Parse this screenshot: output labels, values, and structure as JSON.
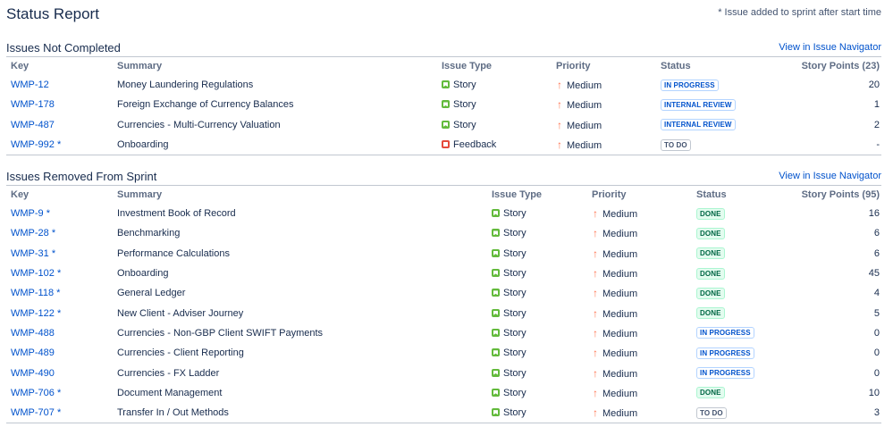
{
  "page": {
    "title": "Status Report",
    "note": "* Issue added to sprint after start time"
  },
  "not_completed": {
    "title": "Issues Not Completed",
    "link": "View in Issue Navigator",
    "columns": [
      "Key",
      "Summary",
      "Issue Type",
      "Priority",
      "Status",
      "Story Points (23)"
    ],
    "rows": [
      {
        "key": "WMP-12",
        "summary": "Money Laundering Regulations",
        "type": "Story",
        "type_icon": "story-icon",
        "priority": "Medium",
        "status": "IN PROGRESS",
        "status_color": "blue",
        "points": "20"
      },
      {
        "key": "WMP-178",
        "summary": "Foreign Exchange of Currency Balances",
        "type": "Story",
        "type_icon": "story-icon",
        "priority": "Medium",
        "status": "INTERNAL REVIEW",
        "status_color": "blue",
        "points": "1"
      },
      {
        "key": "WMP-487",
        "summary": "Currencies - Multi-Currency Valuation",
        "type": "Story",
        "type_icon": "story-icon",
        "priority": "Medium",
        "status": "INTERNAL REVIEW",
        "status_color": "blue",
        "points": "2"
      },
      {
        "key": "WMP-992 *",
        "summary": "Onboarding",
        "type": "Feedback",
        "type_icon": "feedback-icon",
        "priority": "Medium",
        "status": "TO DO",
        "status_color": "grey",
        "points": "-"
      }
    ]
  },
  "removed": {
    "title": "Issues Removed From Sprint",
    "link": "View in Issue Navigator",
    "columns": [
      "Key",
      "Summary",
      "Issue Type",
      "Priority",
      "Status",
      "Story Points (95)"
    ],
    "rows": [
      {
        "key": "WMP-9 *",
        "summary": "Investment Book of Record",
        "type": "Story",
        "type_icon": "story-icon",
        "priority": "Medium",
        "status": "DONE",
        "status_color": "green",
        "points": "16"
      },
      {
        "key": "WMP-28 *",
        "summary": "Benchmarking",
        "type": "Story",
        "type_icon": "story-icon",
        "priority": "Medium",
        "status": "DONE",
        "status_color": "green",
        "points": "6"
      },
      {
        "key": "WMP-31 *",
        "summary": "Performance Calculations",
        "type": "Story",
        "type_icon": "story-icon",
        "priority": "Medium",
        "status": "DONE",
        "status_color": "green",
        "points": "6"
      },
      {
        "key": "WMP-102 *",
        "summary": "Onboarding",
        "type": "Story",
        "type_icon": "story-icon",
        "priority": "Medium",
        "status": "DONE",
        "status_color": "green",
        "points": "45"
      },
      {
        "key": "WMP-118 *",
        "summary": "General Ledger",
        "type": "Story",
        "type_icon": "story-icon",
        "priority": "Medium",
        "status": "DONE",
        "status_color": "green",
        "points": "4"
      },
      {
        "key": "WMP-122 *",
        "summary": "New Client - Adviser Journey",
        "type": "Story",
        "type_icon": "story-icon",
        "priority": "Medium",
        "status": "DONE",
        "status_color": "green",
        "points": "5"
      },
      {
        "key": "WMP-488",
        "summary": "Currencies - Non-GBP Client SWIFT Payments",
        "type": "Story",
        "type_icon": "story-icon",
        "priority": "Medium",
        "status": "IN PROGRESS",
        "status_color": "blue",
        "points": "0"
      },
      {
        "key": "WMP-489",
        "summary": "Currencies - Client Reporting",
        "type": "Story",
        "type_icon": "story-icon",
        "priority": "Medium",
        "status": "IN PROGRESS",
        "status_color": "blue",
        "points": "0"
      },
      {
        "key": "WMP-490",
        "summary": "Currencies - FX Ladder",
        "type": "Story",
        "type_icon": "story-icon",
        "priority": "Medium",
        "status": "IN PROGRESS",
        "status_color": "blue",
        "points": "0"
      },
      {
        "key": "WMP-706 *",
        "summary": "Document Management",
        "type": "Story",
        "type_icon": "story-icon",
        "priority": "Medium",
        "status": "DONE",
        "status_color": "green",
        "points": "10"
      },
      {
        "key": "WMP-707 *",
        "summary": "Transfer In / Out Methods",
        "type": "Story",
        "type_icon": "story-icon",
        "priority": "Medium",
        "status": "TO DO",
        "status_color": "grey",
        "points": "3"
      }
    ]
  },
  "colors": {
    "link": "#0052cc",
    "priority": "#ff7452",
    "story": "#63ba3c",
    "feedback": "#e5493a"
  }
}
